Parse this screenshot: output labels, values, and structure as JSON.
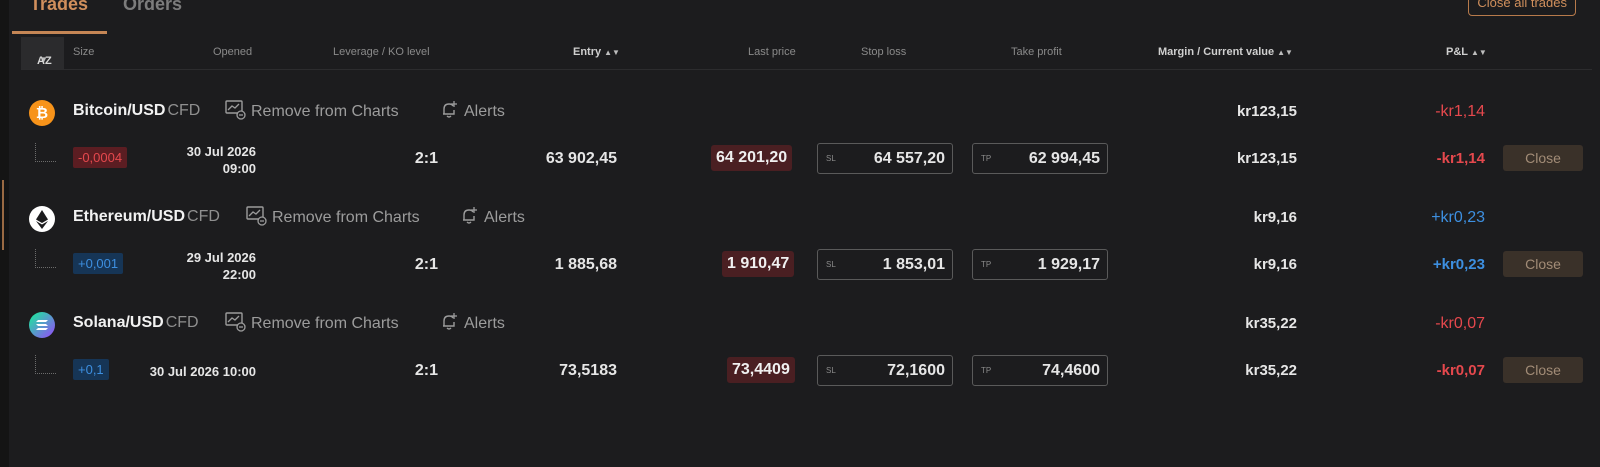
{
  "tabs": [
    {
      "label": "Trades"
    },
    {
      "label": "Orders"
    }
  ],
  "close_all_label": "Close all trades",
  "columns": {
    "az": "AZ",
    "size": "Size",
    "opened": "Opened",
    "leverage": "Leverage / KO level",
    "entry": "Entry",
    "last_price": "Last price",
    "stop_loss": "Stop loss",
    "take_profit": "Take profit",
    "margin": "Margin / Current value",
    "pnl": "P&L"
  },
  "colors": {
    "accent": "#d08f5c",
    "negative": "#e5484d",
    "positive": "#3d8fe0"
  },
  "trades": [
    {
      "name": "Bitcoin/USD",
      "type": "CFD",
      "icon": "bitcoin-icon",
      "remove_label": "Remove from Charts",
      "alerts_label": "Alerts",
      "size": "-0,0004",
      "opened_date": "30 Jul 2026",
      "opened_time": "09:00",
      "leverage": "2:1",
      "entry": "63 902,45",
      "last_price": "64 201,20",
      "sl_label": "SL",
      "stop_loss": "64 557,20",
      "tp_label": "TP",
      "take_profit": "62 994,45",
      "margin": "kr123,15",
      "pnl": "-kr1,14",
      "close_label": "Close"
    },
    {
      "name": "Ethereum/USD",
      "type": "CFD",
      "icon": "ethereum-icon",
      "remove_label": "Remove from Charts",
      "alerts_label": "Alerts",
      "size": "+0,001",
      "opened_date": "29 Jul 2026",
      "opened_time": "22:00",
      "leverage": "2:1",
      "entry": "1 885,68",
      "last_price": "1 910,47",
      "sl_label": "SL",
      "stop_loss": "1 853,01",
      "tp_label": "TP",
      "take_profit": "1 929,17",
      "margin": "kr9,16",
      "pnl": "+kr0,23",
      "close_label": "Close"
    },
    {
      "name": "Solana/USD",
      "type": "CFD",
      "icon": "solana-icon",
      "remove_label": "Remove from Charts",
      "alerts_label": "Alerts",
      "size": "+0,1",
      "opened": "30 Jul 2026 10:00",
      "leverage": "2:1",
      "entry": "73,5183",
      "last_price": "73,4409",
      "sl_label": "SL",
      "stop_loss": "72,1600",
      "tp_label": "TP",
      "take_profit": "74,4600",
      "margin": "kr35,22",
      "pnl": "-kr0,07",
      "close_label": "Close"
    }
  ]
}
